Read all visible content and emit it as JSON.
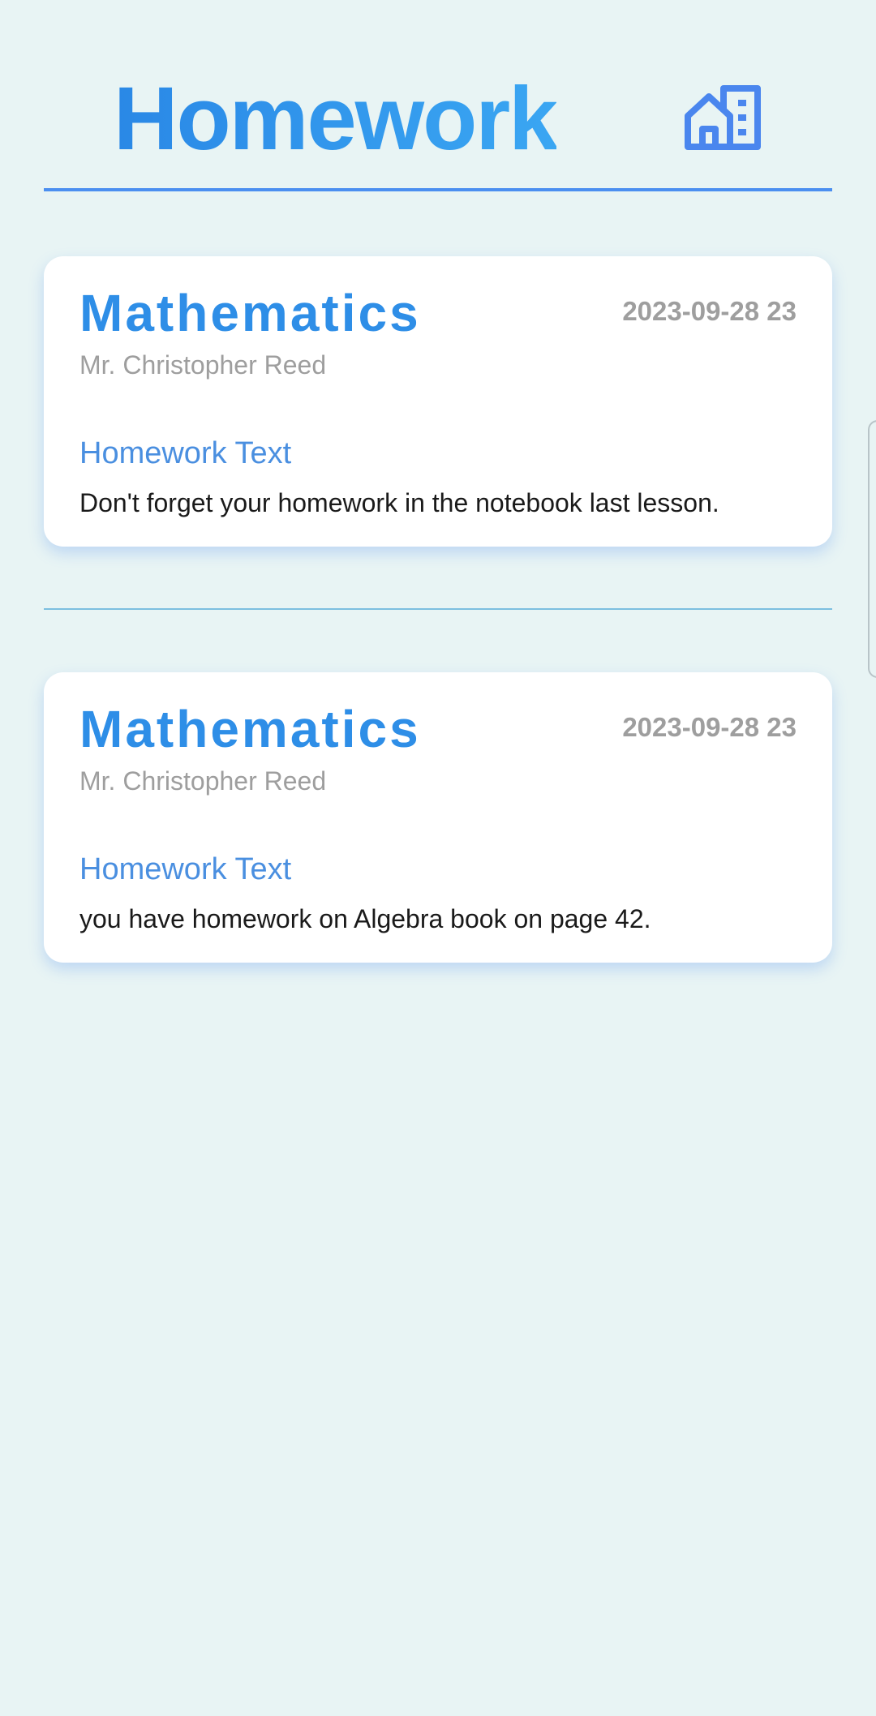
{
  "header": {
    "title": "Homework",
    "icon": "home-building-icon"
  },
  "colors": {
    "accent": "#2e8ee7",
    "background": "#e8f4f4",
    "divider": "#4b8ff0",
    "muted": "#9e9e9e"
  },
  "homework": [
    {
      "subject": "Mathematics",
      "date": "2023-09-28 23",
      "teacher": "Mr. Christopher Reed",
      "label": "Homework Text",
      "text": "Don't forget your homework in the notebook last lesson."
    },
    {
      "subject": "Mathematics",
      "date": "2023-09-28 23",
      "teacher": "Mr. Christopher Reed",
      "label": "Homework Text",
      "text": "you have homework on Algebra book on page 42."
    }
  ]
}
